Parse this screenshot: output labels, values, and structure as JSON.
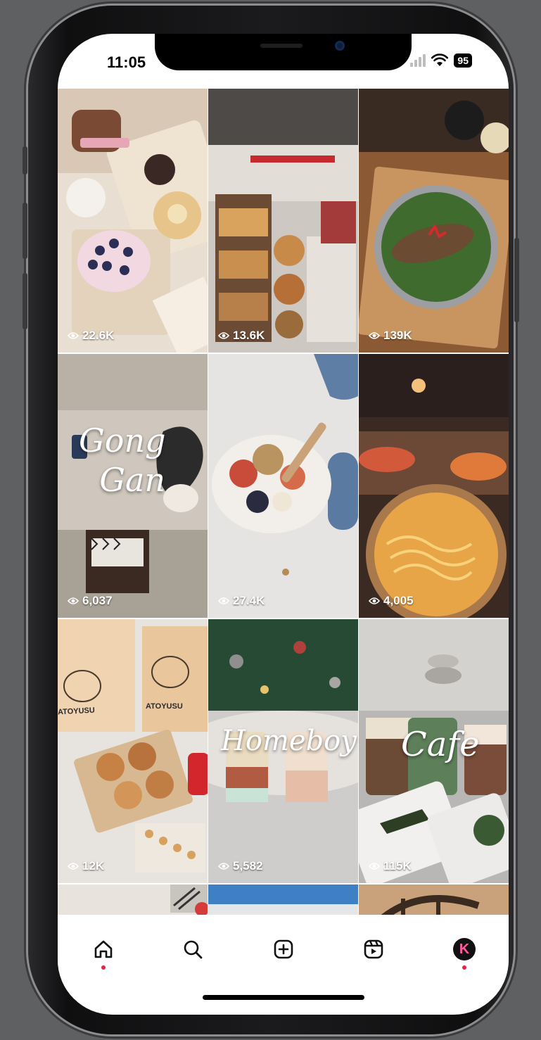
{
  "status_bar": {
    "time": "11:05",
    "battery": "95"
  },
  "grid": {
    "tiles": [
      {
        "id": "cakes-box",
        "views": "22.6K",
        "overlay": ""
      },
      {
        "id": "bakery-store",
        "views": "13.6K",
        "overlay": ""
      },
      {
        "id": "fish-bowl",
        "views": "139K",
        "overlay": ""
      },
      {
        "id": "gong-gan-cafe",
        "views": "6,037",
        "overlay": "Gong\nGan"
      },
      {
        "id": "fruit-bowl",
        "views": "27.4K",
        "overlay": ""
      },
      {
        "id": "buffet-noodles",
        "views": "4,005",
        "overlay": ""
      },
      {
        "id": "atoyusu-bakery",
        "views": "12K",
        "overlay": ""
      },
      {
        "id": "homeboy-drinks",
        "views": "5,582",
        "overlay": "Homeboy"
      },
      {
        "id": "cafe-drinks",
        "views": "115K",
        "overlay": "Cafe"
      }
    ],
    "bag_brand": "ATOYUSU"
  },
  "tab_bar": {
    "items": [
      "home",
      "search",
      "create",
      "reels",
      "profile"
    ],
    "profile_initial": "K",
    "accent": "#e8223f"
  },
  "colors": {
    "background": "#5f6062",
    "screen": "#ffffff"
  }
}
